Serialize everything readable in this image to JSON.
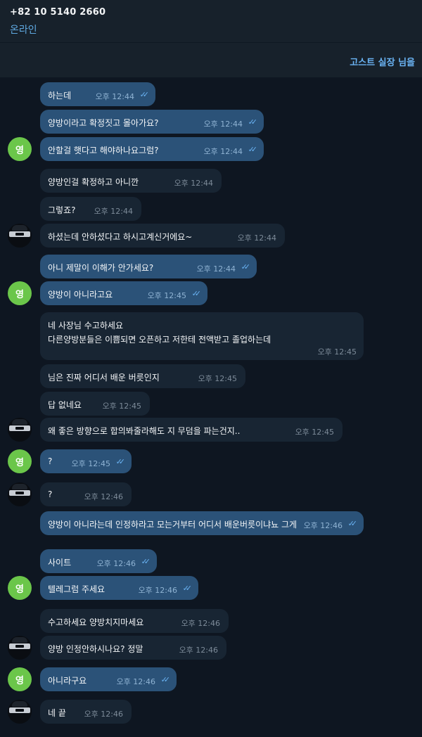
{
  "header": {
    "phone": "+82 10 5140 2660",
    "status": "온라인"
  },
  "pinned": {
    "text": "고스트 실장 님을"
  },
  "colors": {
    "background": "#0e1621",
    "header_bg": "#17212b",
    "outgoing_bubble": "#2b5278",
    "incoming_bubble": "#182533",
    "avatar_green": "#6bc64a",
    "accent": "#6ab3f3"
  },
  "messages": [
    {
      "id": 0,
      "dir": "out",
      "text": "하는데",
      "time": "오후 12:44",
      "read": true
    },
    {
      "id": 1,
      "dir": "out",
      "text": "양방이라고 확정짓고 몰아가요?",
      "time": "오후 12:44",
      "read": true
    },
    {
      "id": 2,
      "dir": "out",
      "text": "안할걸 햇다고 해야하나요그럼?",
      "time": "오후 12:44",
      "read": true,
      "avatar": "영"
    },
    {
      "id": 3,
      "dir": "in",
      "text": "양방인걸 확정하고 아니깐",
      "time": "오후 12:44"
    },
    {
      "id": 4,
      "dir": "in",
      "text": "그렇죠?",
      "time": "오후 12:44"
    },
    {
      "id": 5,
      "dir": "in",
      "text": "하셨는데 안하셨다고 하시고계신거에요~",
      "time": "오후 12:44",
      "avatar": "dark-avatar"
    },
    {
      "id": 6,
      "dir": "out",
      "text": "아니 제말이 이해가 안가세요?",
      "time": "오후 12:44",
      "read": true
    },
    {
      "id": 7,
      "dir": "out",
      "text": "양방이 아니라고요",
      "time": "오후 12:45",
      "read": true,
      "avatar": "영"
    },
    {
      "id": 8,
      "dir": "in",
      "lines": [
        "네 사장님 수고하세요",
        "다른양방분들은 이쁨되면 오픈하고 저한테 전액받고 졸업하는데"
      ],
      "time": "오후 12:45"
    },
    {
      "id": 9,
      "dir": "in",
      "text": "님은 진짜 어디서 배운 버릇인지",
      "time": "오후 12:45"
    },
    {
      "id": 10,
      "dir": "in",
      "text": "답 없네요",
      "time": "오후 12:45"
    },
    {
      "id": 11,
      "dir": "in",
      "text": "왜 좋은 방향으로 합의봐줄라해도 지 무덤을 파는건지..",
      "time": "오후 12:45",
      "avatar": "dark-avatar"
    },
    {
      "id": 12,
      "dir": "out",
      "text": "?",
      "time": "오후 12:45",
      "read": true,
      "avatar": "영"
    },
    {
      "id": 13,
      "dir": "in",
      "text": "?",
      "time": "오후 12:46",
      "avatar": "dark-avatar"
    },
    {
      "id": 14,
      "dir": "out",
      "text": "양방이 아니라는데 인정하라고 모는거부터 어디서 배운버릇이냐뇨 그게",
      "time": "오후 12:46",
      "read": true
    },
    {
      "id": 15,
      "dir": "out",
      "text": "사이트",
      "time": "오후 12:46",
      "read": true
    },
    {
      "id": 16,
      "dir": "out",
      "text": "텔레그럼 주세요",
      "time": "오후 12:46",
      "read": true,
      "avatar": "영"
    },
    {
      "id": 17,
      "dir": "in",
      "text": "수고하세요 양방치지마세요",
      "time": "오후 12:46"
    },
    {
      "id": 18,
      "dir": "in",
      "text": "양방 인정안하시나요? 정말",
      "time": "오후 12:46",
      "avatar": "dark-avatar"
    },
    {
      "id": 19,
      "dir": "out",
      "text": "아니라구요",
      "time": "오후 12:46",
      "read": true,
      "avatar": "영"
    },
    {
      "id": 20,
      "dir": "in",
      "text": "네 끝",
      "time": "오후 12:46",
      "avatar": "dark-avatar"
    }
  ]
}
